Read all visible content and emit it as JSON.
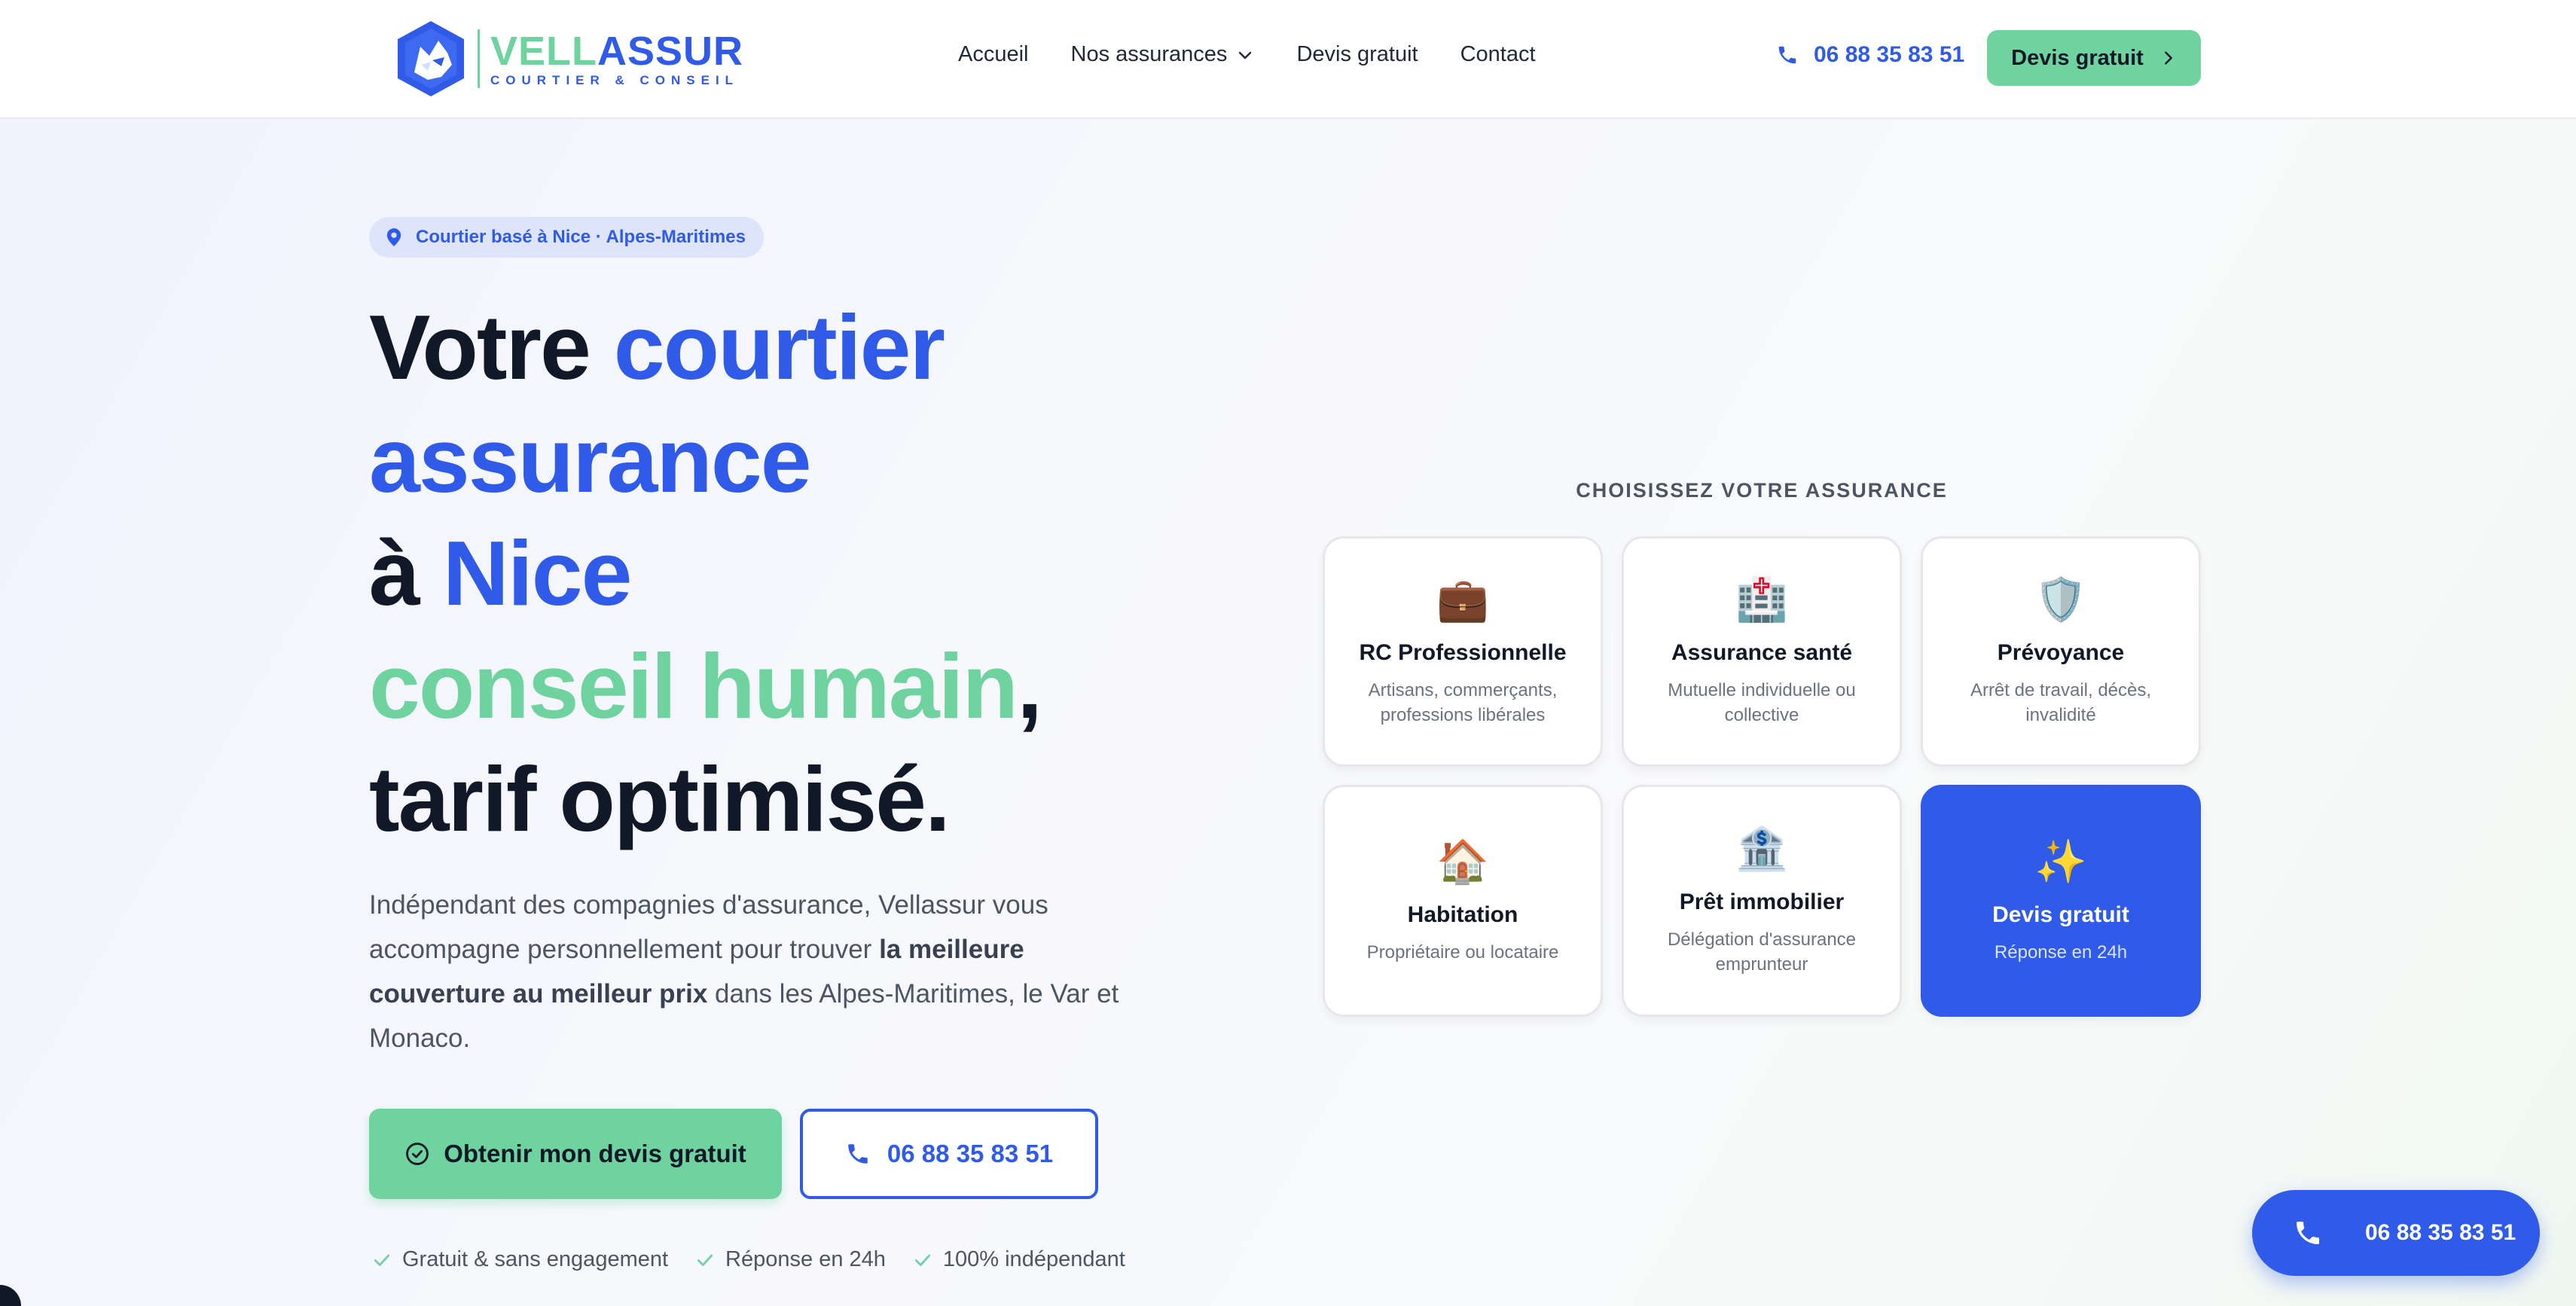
{
  "header": {
    "logo": {
      "brand_part1": "VELL",
      "brand_part2": "ASSUR",
      "tagline": "COURTIER & CONSEIL"
    },
    "nav": [
      {
        "label": "Accueil"
      },
      {
        "label": "Nos assurances",
        "has_dropdown": true
      },
      {
        "label": "Devis gratuit"
      },
      {
        "label": "Contact"
      }
    ],
    "phone": "06 88 35 83 51",
    "cta_label": "Devis gratuit"
  },
  "hero": {
    "badge": "Courtier basé à Nice · Alpes-Maritimes",
    "title": {
      "line1_a": "Votre ",
      "line1_b": "courtier",
      "line2": "assurance",
      "line3_a": "à ",
      "line3_b": "Nice",
      "line4_a": "conseil humain",
      "line4_b": ",",
      "line5": "tarif optimisé."
    },
    "description": {
      "part1": "Indépendant des compagnies d'assurance, Vellassur vous accompagne personnellement pour trouver ",
      "bold": "la meilleure couverture au meilleur prix",
      "part2": " dans les Alpes-Maritimes, le Var et Monaco."
    },
    "primary_button": "Obtenir mon devis gratuit",
    "phone_button": "06 88 35 83 51",
    "trust": [
      "Gratuit & sans engagement",
      "Réponse en 24h",
      "100% indépendant"
    ]
  },
  "insurance": {
    "heading": "CHOISISSEZ VOTRE ASSURANCE",
    "cards": [
      {
        "icon": "💼",
        "icon_name": "briefcase-icon",
        "title": "RC Professionnelle",
        "desc": "Artisans, commerçants, professions libérales"
      },
      {
        "icon": "🏥",
        "icon_name": "hospital-icon",
        "title": "Assurance santé",
        "desc": "Mutuelle individuelle ou collective"
      },
      {
        "icon": "🛡️",
        "icon_name": "shield-icon",
        "title": "Prévoyance",
        "desc": "Arrêt de travail, décès, invalidité"
      },
      {
        "icon": "🏠",
        "icon_name": "house-icon",
        "title": "Habitation",
        "desc": "Propriétaire ou locataire"
      },
      {
        "icon": "🏦",
        "icon_name": "bank-icon",
        "title": "Prêt immobilier",
        "desc": "Délégation d'assurance emprunteur"
      },
      {
        "icon": "✨",
        "icon_name": "sparkles-icon",
        "title": "Devis gratuit",
        "desc": "Réponse en 24h",
        "featured": true
      }
    ]
  },
  "floating_phone": "06 88 35 83 51",
  "colors": {
    "primary_blue": "#2f5be8",
    "accent_green": "#6fd3a0",
    "text_dark": "#111827",
    "text_muted": "#4b5563"
  }
}
